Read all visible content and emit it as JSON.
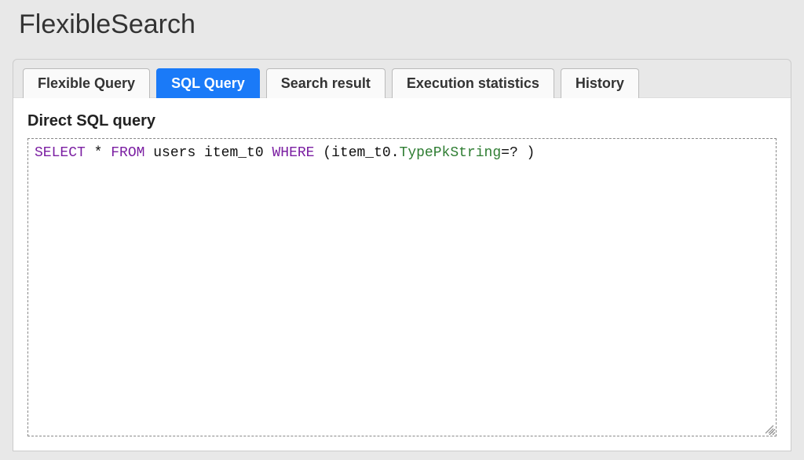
{
  "header": {
    "title": "FlexibleSearch"
  },
  "tabs": [
    {
      "id": "flexible-query",
      "label": "Flexible Query",
      "active": false
    },
    {
      "id": "sql-query",
      "label": "SQL Query",
      "active": true
    },
    {
      "id": "search-result",
      "label": "Search result",
      "active": false
    },
    {
      "id": "execution-statistics",
      "label": "Execution statistics",
      "active": false
    },
    {
      "id": "history",
      "label": "History",
      "active": false
    }
  ],
  "section": {
    "title": "Direct SQL query"
  },
  "sql": {
    "raw": "SELECT * FROM users item_t0 WHERE (item_t0.TypePkString=? )",
    "tokens": [
      {
        "text": "SELECT",
        "cls": "kw"
      },
      {
        "text": " * ",
        "cls": "plain"
      },
      {
        "text": "FROM",
        "cls": "kw"
      },
      {
        "text": " users item_t0 ",
        "cls": "plain"
      },
      {
        "text": "WHERE",
        "cls": "kw"
      },
      {
        "text": " (item_t0.",
        "cls": "plain"
      },
      {
        "text": "TypePkString",
        "cls": "fld"
      },
      {
        "text": "=? )",
        "cls": "plain"
      }
    ]
  }
}
